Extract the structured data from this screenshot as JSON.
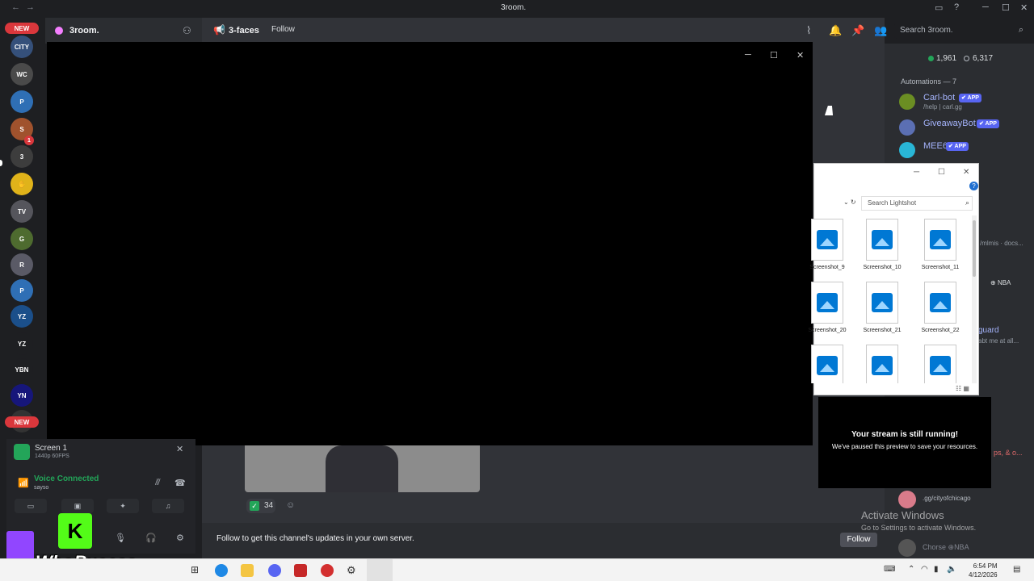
{
  "window": {
    "title": "3room.",
    "back": "←",
    "forward": "→",
    "controls": [
      "─",
      "☐",
      "✕"
    ]
  },
  "rail": {
    "new_badge_top": "NEW",
    "new_badge_bottom": "NEW",
    "notification_count": "1"
  },
  "server": {
    "name": "3room.",
    "dropdown": "⌄"
  },
  "channel": {
    "name": "3-faces",
    "follow": "Follow"
  },
  "search": {
    "placeholder": "Search 3room."
  },
  "members": {
    "online_count": "1,961",
    "total_count": "6,317",
    "automations_label": "Automations — 7",
    "bots": [
      {
        "name": "Carl-bot",
        "tag": "✔ APP",
        "sub": "/help | carl.gg",
        "color": "#6b8e23"
      },
      {
        "name": "GiveawayBot",
        "tag": "✔ APP",
        "sub": "",
        "color": "#5b6fb3"
      },
      {
        "name": "MEE6",
        "tag": "✔ APP",
        "sub": "",
        "color": "#29b6d6"
      }
    ]
  },
  "popout": {
    "minimize": "─",
    "maximize": "☐",
    "close": "✕"
  },
  "explorer": {
    "search_placeholder": "Search Lightshot",
    "files": [
      {
        "label": "Screenshot_9"
      },
      {
        "label": "Screenshot_10"
      },
      {
        "label": "Screenshot_11"
      },
      {
        "label": "Screenshot_20"
      },
      {
        "label": "Screenshot_21"
      },
      {
        "label": "Screenshot_22"
      },
      {
        "label": ""
      },
      {
        "label": ""
      },
      {
        "label": ""
      }
    ]
  },
  "preview": {
    "title": "Your stream is still running!",
    "subtitle": "We've paused this preview to save your resources."
  },
  "voice": {
    "screen_name": "Screen 1",
    "screen_res": "1440p 60FPS",
    "status": "Voice Connected",
    "channel": "saysо"
  },
  "watermark": {
    "name": "WhoBuccss",
    "kick_letter": "K"
  },
  "message": {
    "reaction_count": "34",
    "reaction_icon": "✓"
  },
  "followbar": {
    "text": "Follow to get this channel's updates in your own server.",
    "button": "Follow"
  },
  "member_list_more": {
    "member1": ".gg/cityofchicago",
    "member2": "Chorse",
    "member2_tag": "NBA"
  },
  "side_texts": {
    "nba": "NBA",
    "guard": "guard",
    "guard_sub": "abt me at all...",
    "docs": "/mlmis · docs...",
    "ps": "ps, & o..."
  },
  "activate": {
    "title": "Activate Windows",
    "subtitle": "Go to Settings to activate Windows."
  },
  "taskbar": {
    "time": "6:54 PM",
    "date": "4/12/2026"
  }
}
